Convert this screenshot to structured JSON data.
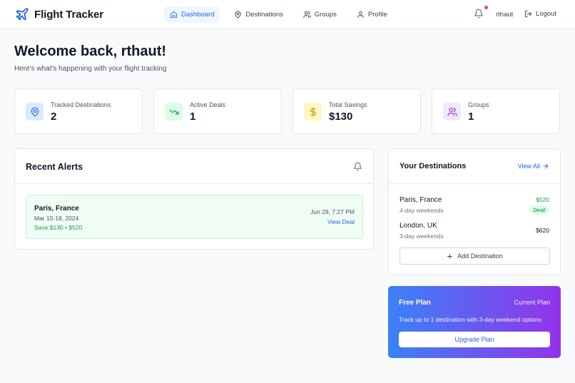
{
  "header": {
    "brand": "Flight Tracker",
    "nav": [
      {
        "label": "Dashboard",
        "icon": "home-icon",
        "active": true
      },
      {
        "label": "Destinations",
        "icon": "map-pin-icon",
        "active": false
      },
      {
        "label": "Groups",
        "icon": "users-icon",
        "active": false
      },
      {
        "label": "Profile",
        "icon": "user-icon",
        "active": false
      }
    ],
    "username": "rthaut",
    "logout_label": "Logout"
  },
  "welcome": {
    "title": "Welcome back, rthaut!",
    "subtitle": "Here's what's happening with your flight tracking"
  },
  "stats": [
    {
      "label": "Tracked Destinations",
      "value": "2",
      "icon": "map-pin-icon",
      "bg": "#dbeafe",
      "fg": "#2563eb"
    },
    {
      "label": "Active Deals",
      "value": "1",
      "icon": "trending-down-icon",
      "bg": "#dcfce7",
      "fg": "#16a34a"
    },
    {
      "label": "Total Savings",
      "value": "$130",
      "icon": "dollar-icon",
      "bg": "#fef9c3",
      "fg": "#ca8a04"
    },
    {
      "label": "Groups",
      "value": "1",
      "icon": "users-icon",
      "bg": "#f3e8ff",
      "fg": "#9333ea"
    }
  ],
  "alerts": {
    "title": "Recent Alerts",
    "items": [
      {
        "destination": "Paris, France",
        "dates": "Mar 15-18, 2024",
        "savings": "Save $130 • $520",
        "time": "Jun 29, 7:27 PM",
        "link": "View Deal"
      }
    ]
  },
  "destinations": {
    "title": "Your Destinations",
    "view_all": "View All",
    "items": [
      {
        "name": "Paris, France",
        "sub": "4-day weekends",
        "price": "$520",
        "deal": "Deal!",
        "price_color": "#16a34a"
      },
      {
        "name": "London, UK",
        "sub": "3-day weekends",
        "price": "$620",
        "deal": "",
        "price_color": "#111827"
      }
    ],
    "add_label": "Add Destination"
  },
  "plan": {
    "name": "Free Plan",
    "current": "Current Plan",
    "description": "Track up to 1 destination with 3-day weekend options",
    "upgrade_label": "Upgrade Plan"
  },
  "colors": {
    "accent": "#2563eb",
    "success": "#16a34a",
    "notification": "#ef4444"
  }
}
